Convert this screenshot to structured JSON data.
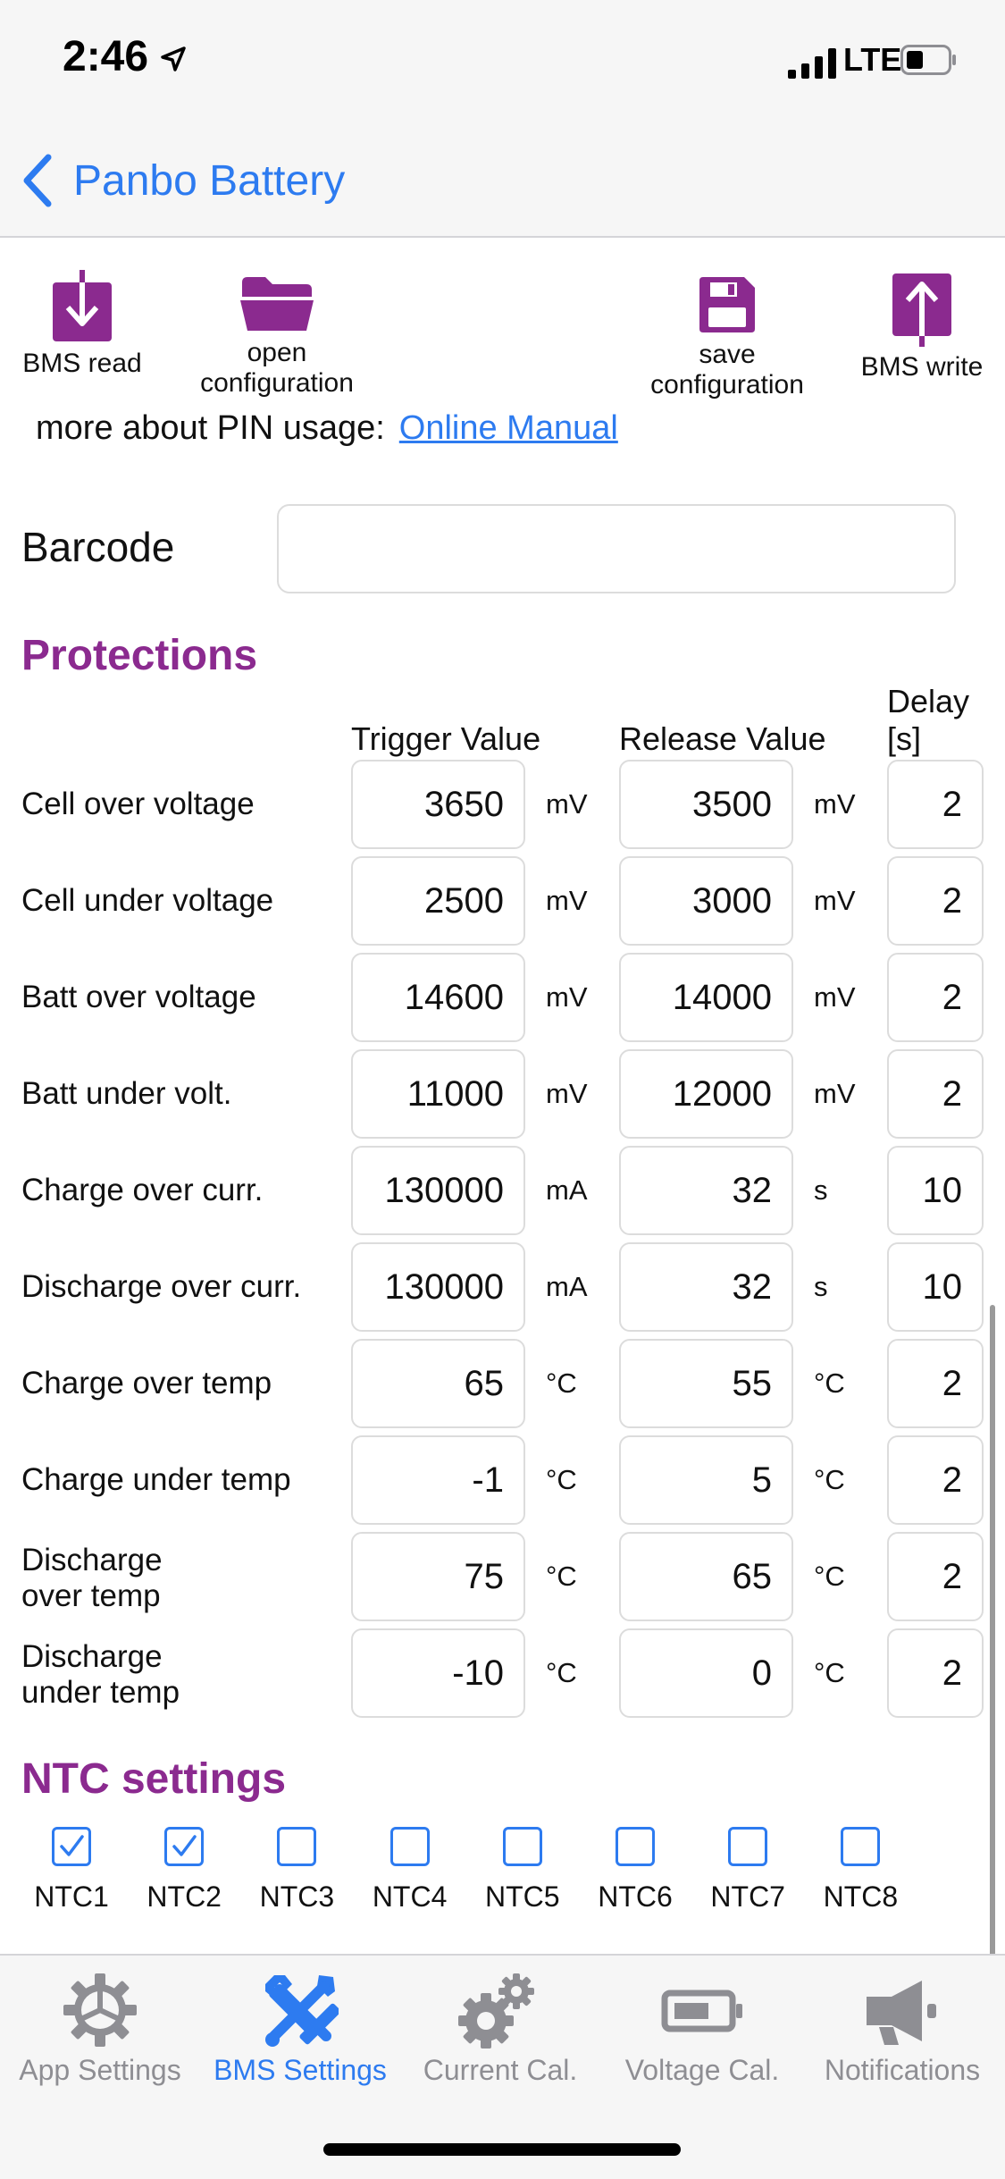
{
  "status_bar": {
    "time": "2:46",
    "network": "LTE"
  },
  "nav": {
    "back_label": "Panbo Battery"
  },
  "toolbar": {
    "bms_read": "BMS read",
    "open_config_1": "open",
    "open_config_2": "configuration",
    "save_config_1": "save",
    "save_config_2": "configuration",
    "bms_write": "BMS write"
  },
  "pin": {
    "text": "more about PIN usage:",
    "link": "Online Manual"
  },
  "barcode": {
    "label": "Barcode",
    "value": ""
  },
  "protections": {
    "title": "Protections",
    "headers": {
      "trigger": "Trigger Value",
      "release": "Release Value",
      "delay_1": "Delay",
      "delay_2": "[s]"
    },
    "rows": [
      {
        "label1": "Cell over voltage",
        "label2": "",
        "trigger": "3650",
        "trigger_unit": "mV",
        "release": "3500",
        "release_unit": "mV",
        "delay": "2"
      },
      {
        "label1": "Cell under voltage",
        "label2": "",
        "trigger": "2500",
        "trigger_unit": "mV",
        "release": "3000",
        "release_unit": "mV",
        "delay": "2"
      },
      {
        "label1": "Batt over voltage",
        "label2": "",
        "trigger": "14600",
        "trigger_unit": "mV",
        "release": "14000",
        "release_unit": "mV",
        "delay": "2"
      },
      {
        "label1": "Batt under volt.",
        "label2": "",
        "trigger": "11000",
        "trigger_unit": "mV",
        "release": "12000",
        "release_unit": "mV",
        "delay": "2"
      },
      {
        "label1": "Charge over curr.",
        "label2": "",
        "trigger": "130000",
        "trigger_unit": "mA",
        "release": "32",
        "release_unit": "s",
        "delay": "10"
      },
      {
        "label1": "Discharge over curr.",
        "label2": "",
        "trigger": "130000",
        "trigger_unit": "mA",
        "release": "32",
        "release_unit": "s",
        "delay": "10"
      },
      {
        "label1": "Charge over temp",
        "label2": "",
        "trigger": "65",
        "trigger_unit": "°C",
        "release": "55",
        "release_unit": "°C",
        "delay": "2"
      },
      {
        "label1": "Charge under temp",
        "label2": "",
        "trigger": "-1",
        "trigger_unit": "°C",
        "release": "5",
        "release_unit": "°C",
        "delay": "2"
      },
      {
        "label1": "Discharge",
        "label2": "over temp",
        "trigger": "75",
        "trigger_unit": "°C",
        "release": "65",
        "release_unit": "°C",
        "delay": "2"
      },
      {
        "label1": "Discharge",
        "label2": "under temp",
        "trigger": "-10",
        "trigger_unit": "°C",
        "release": "0",
        "release_unit": "°C",
        "delay": "2"
      }
    ]
  },
  "ntc": {
    "title": "NTC settings",
    "items": [
      {
        "label": "NTC1",
        "checked": true
      },
      {
        "label": "NTC2",
        "checked": true
      },
      {
        "label": "NTC3",
        "checked": false
      },
      {
        "label": "NTC4",
        "checked": false
      },
      {
        "label": "NTC5",
        "checked": false
      },
      {
        "label": "NTC6",
        "checked": false
      },
      {
        "label": "NTC7",
        "checked": false
      },
      {
        "label": "NTC8",
        "checked": false
      }
    ]
  },
  "tabs": [
    {
      "label": "App Settings",
      "icon": "gear-icon",
      "active": false
    },
    {
      "label": "BMS Settings",
      "icon": "wrench-screwdriver-icon",
      "active": true
    },
    {
      "label": "Current Cal.",
      "icon": "gears-icon",
      "active": false
    },
    {
      "label": "Voltage Cal.",
      "icon": "battery-icon",
      "active": false
    },
    {
      "label": "Notifications",
      "icon": "megaphone-icon",
      "active": false
    }
  ],
  "colors": {
    "accent": "#2d7bf0",
    "brand": "#8b2a8f",
    "tab_inactive": "#8e8e93"
  }
}
